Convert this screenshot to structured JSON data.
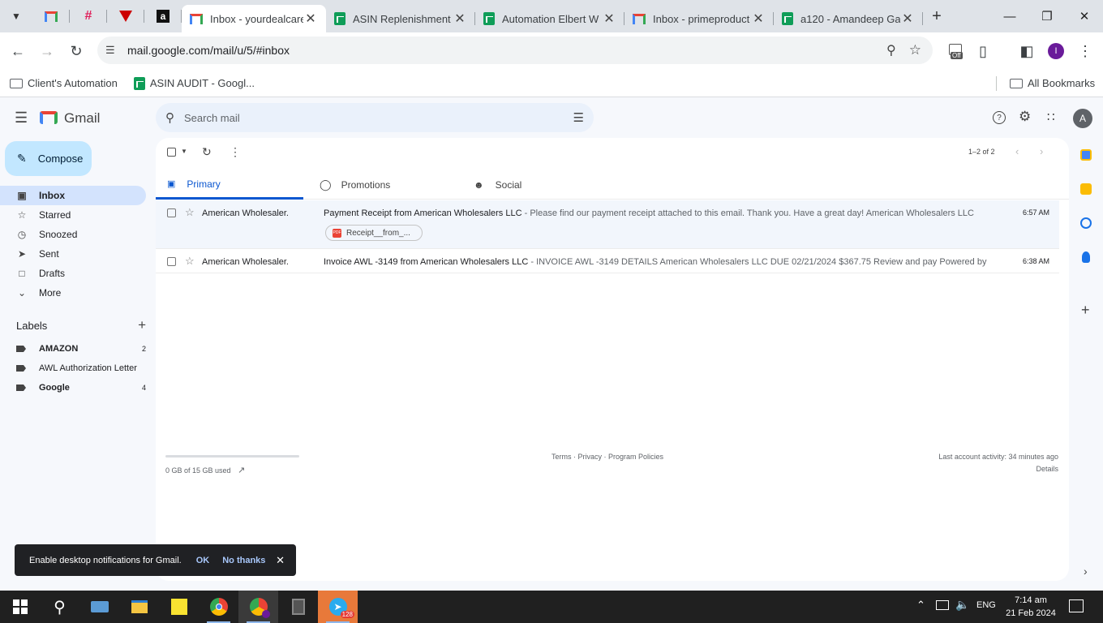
{
  "browser": {
    "tabs": [
      {
        "title": "Inbox - yourdealcare(",
        "icon": "gmail-icon",
        "active": true
      },
      {
        "title": "ASIN Replenishment",
        "icon": "sheets-icon"
      },
      {
        "title": "Automation Elbert W",
        "icon": "sheets-icon"
      },
      {
        "title": "Inbox - primeproduct",
        "icon": "gmail-icon"
      },
      {
        "title": "a120 - Amandeep Ga",
        "icon": "sheets-icon"
      }
    ],
    "url": "mail.google.com/mail/u/5/#inbox",
    "extension_badge": "Off",
    "profile_initial": "I",
    "bookmarks": [
      "Client's Automation",
      "ASIN AUDIT - Googl..."
    ],
    "all_bookmarks": "All Bookmarks"
  },
  "gmail": {
    "logo_text": "Gmail",
    "search_placeholder": "Search mail",
    "account_initial": "A",
    "compose_label": "Compose",
    "nav": [
      {
        "label": "Inbox",
        "icon": "inbox-icon",
        "active": true
      },
      {
        "label": "Starred",
        "icon": "star-icon"
      },
      {
        "label": "Snoozed",
        "icon": "clock-icon"
      },
      {
        "label": "Sent",
        "icon": "send-icon"
      },
      {
        "label": "Drafts",
        "icon": "draft-icon"
      },
      {
        "label": "More",
        "icon": "chevron-down-icon"
      }
    ],
    "labels_heading": "Labels",
    "labels": [
      {
        "name": "AMAZON",
        "count": "2",
        "bold": true
      },
      {
        "name": "AWL Authorization Letter",
        "count": "",
        "bold": false
      },
      {
        "name": "Google",
        "count": "4",
        "bold": true
      }
    ],
    "pagination": "1–2 of 2",
    "inbox_tabs": [
      "Primary",
      "Promotions",
      "Social"
    ],
    "emails": [
      {
        "sender": "American Wholesaler.",
        "subject": "Payment Receipt from American Wholesalers LLC",
        "snippet": " - Please find our payment receipt attached to this email. Thank you. Have a great day! American Wholesalers LLC",
        "time": "6:57 AM",
        "attachment": "Receipt__from_..."
      },
      {
        "sender": "American Wholesaler.",
        "subject": "Invoice AWL -3149 from American Wholesalers LLC",
        "snippet": " - INVOICE AWL -3149 DETAILS American Wholesalers LLC DUE 02/21/2024 $367.75 Review and pay Powered by QuickBo...",
        "time": "6:38 AM"
      }
    ],
    "storage_text": "0 GB of 15 GB used",
    "storage_used": 0,
    "footer_links": "Terms · Privacy · Program Policies",
    "last_activity": "Last account activity: 34 minutes ago",
    "details": "Details",
    "toast": {
      "text": "Enable desktop notifications for Gmail.",
      "ok": "OK",
      "no": "No thanks"
    }
  },
  "taskbar": {
    "telegram_badge": "128",
    "language": "ENG",
    "time": "7:14 am",
    "date": "21 Feb 2024"
  }
}
